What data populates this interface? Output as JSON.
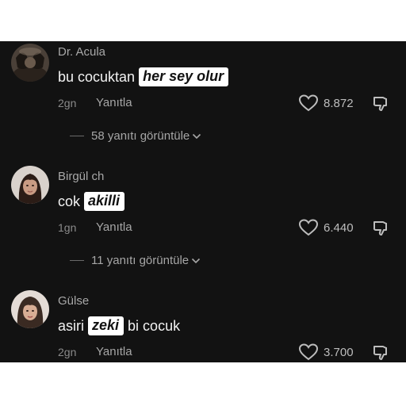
{
  "comments": [
    {
      "username": "Dr. Acula",
      "text_before": "bu cocuktan",
      "highlight": "her sey olur",
      "text_after": "",
      "time": "2gn",
      "reply_label": "Yanıtla",
      "likes": "8.872",
      "view_replies": "58 yanıtı görüntüle"
    },
    {
      "username": "Birgül ch",
      "text_before": "cok",
      "highlight": "akilli",
      "text_after": "",
      "time": "1gn",
      "reply_label": "Yanıtla",
      "likes": "6.440",
      "view_replies": "11 yanıtı görüntüle"
    },
    {
      "username": "Gülse",
      "text_before": "asiri",
      "highlight": "zeki",
      "text_after": "bi cocuk",
      "time": "2gn",
      "reply_label": "Yanıtla",
      "likes": "3.700"
    }
  ],
  "icons": {
    "like": "heart-icon",
    "dislike": "thumbs-down-icon",
    "expand": "chevron-down-icon"
  },
  "colors": {
    "background": "#121212",
    "text": "#f2f2f2",
    "muted": "#8a8a8a",
    "highlight_bg": "#ffffff"
  }
}
